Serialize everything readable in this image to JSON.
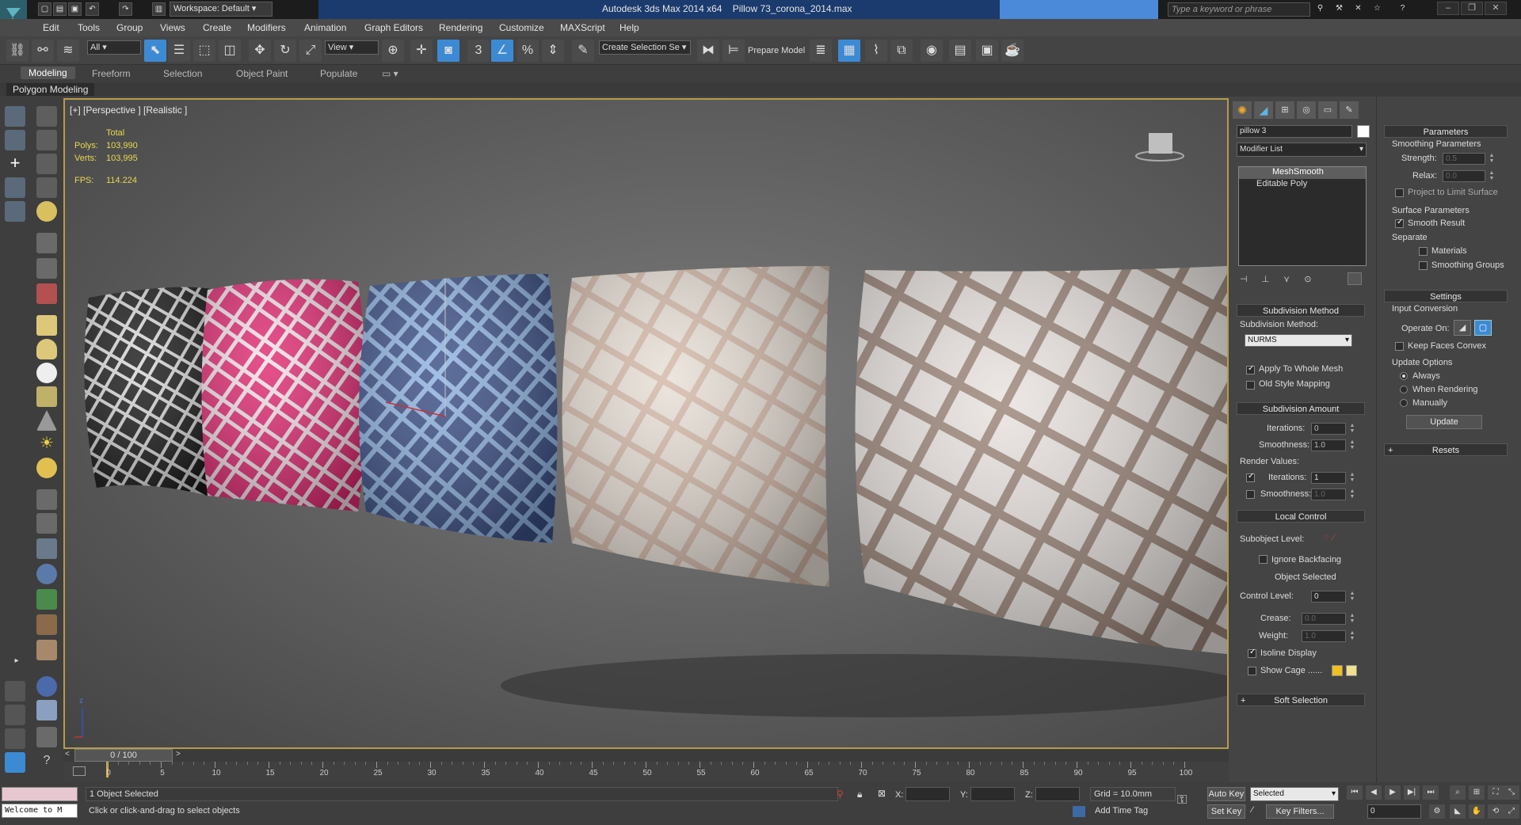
{
  "title": {
    "app": "Autodesk 3ds Max  2014 x64",
    "file": "Pillow 73_corona_2014.max",
    "workspace": "Workspace: Default",
    "search_placeholder": "Type a keyword or phrase"
  },
  "menu": [
    "Edit",
    "Tools",
    "Group",
    "Views",
    "Create",
    "Modifiers",
    "Animation",
    "Graph Editors",
    "Rendering",
    "Customize",
    "MAXScript",
    "Help"
  ],
  "toolbar": {
    "selection_filter": "All",
    "ref_coord": "View",
    "selection_set": "Create Selection Se",
    "prepare_model": "Prepare Model",
    "snap_3": "3",
    "percent_snap": "%",
    "numeric": "n"
  },
  "ribbon": {
    "tabs": [
      "Modeling",
      "Freeform",
      "Selection",
      "Object Paint",
      "Populate"
    ],
    "active": "Modeling",
    "sub_label": "Polygon Modeling"
  },
  "viewport": {
    "label": "[+] [Perspective ] [Realistic ]",
    "stats_header": "Total",
    "polys_label": "Polys:",
    "polys_value": "103,990",
    "verts_label": "Verts:",
    "verts_value": "103,995",
    "fps_label": "FPS:",
    "fps_value": "114.224",
    "axis_z": "z",
    "pillow_colors": [
      "#1a1a1a",
      "#e02a72",
      "#3b4f86",
      "#e8dfd6",
      "#e8e2de"
    ],
    "stripe_colors": [
      "#d8d8d8",
      "#f2e0e8",
      "#8fb3e0",
      "#d4b8a8",
      "#9a8478"
    ]
  },
  "command_panel": {
    "object_name": "pillow 3",
    "modifier_list": "Modifier List",
    "stack": [
      "MeshSmooth",
      "Editable Poly"
    ],
    "subdivision_method": {
      "header": "Subdivision Method",
      "label": "Subdivision Method:",
      "value": "NURMS",
      "apply_whole_mesh": "Apply To Whole Mesh",
      "old_style": "Old Style Mapping"
    },
    "subdivision_amount": {
      "header": "Subdivision Amount",
      "iterations_label": "Iterations:",
      "iterations_value": "0",
      "smoothness_label": "Smoothness:",
      "smoothness_value": "1.0",
      "render_values": "Render Values:",
      "r_iterations_label": "Iterations:",
      "r_iterations_value": "1",
      "r_smoothness_label": "Smoothness:",
      "r_smoothness_value": "1.0"
    },
    "local_control": {
      "header": "Local Control",
      "subobject": "Subobject Level:",
      "ignore_backfacing": "Ignore Backfacing",
      "object_selected": "Object Selected",
      "control_level_label": "Control Level:",
      "control_level_value": "0",
      "crease_label": "Crease:",
      "crease_value": "0.0",
      "weight_label": "Weight:",
      "weight_value": "1.0",
      "isoline": "Isoline Display",
      "show_cage": "Show Cage ......"
    },
    "soft_selection": "Soft Selection"
  },
  "parameters_panel": {
    "header": "Parameters",
    "smoothing_params": "Smoothing Parameters",
    "strength_label": "Strength:",
    "strength_value": "0.5",
    "relax_label": "Relax:",
    "relax_value": "0.0",
    "project_limit": "Project to Limit Surface",
    "surface_params": "Surface Parameters",
    "smooth_result": "Smooth Result",
    "separate": "Separate",
    "materials": "Materials",
    "smoothing_groups": "Smoothing Groups",
    "settings_header": "Settings",
    "input_conversion": "Input Conversion",
    "operate_on": "Operate On:",
    "keep_faces_convex": "Keep Faces Convex",
    "update_options": "Update Options",
    "always": "Always",
    "when_rendering": "When Rendering",
    "manually": "Manually",
    "update_btn": "Update",
    "resets_header": "Resets"
  },
  "timeline": {
    "position": "0 / 100",
    "ticks": [
      "0",
      "5",
      "10",
      "15",
      "20",
      "25",
      "30",
      "35",
      "40",
      "45",
      "50",
      "55",
      "60",
      "65",
      "70",
      "75",
      "80",
      "85",
      "90",
      "95",
      "100"
    ]
  },
  "status": {
    "selected": "1 Object Selected",
    "prompt": "Click or click-and-drag to select objects",
    "welcome": "Welcome to M",
    "x_label": "X:",
    "y_label": "Y:",
    "z_label": "Z:",
    "grid": "Grid = 10.0mm",
    "add_time_tag": "Add Time Tag",
    "auto_key": "Auto Key",
    "set_key": "Set Key",
    "key_mode": "Selected",
    "key_filters": "Key Filters...",
    "frame": "0"
  }
}
